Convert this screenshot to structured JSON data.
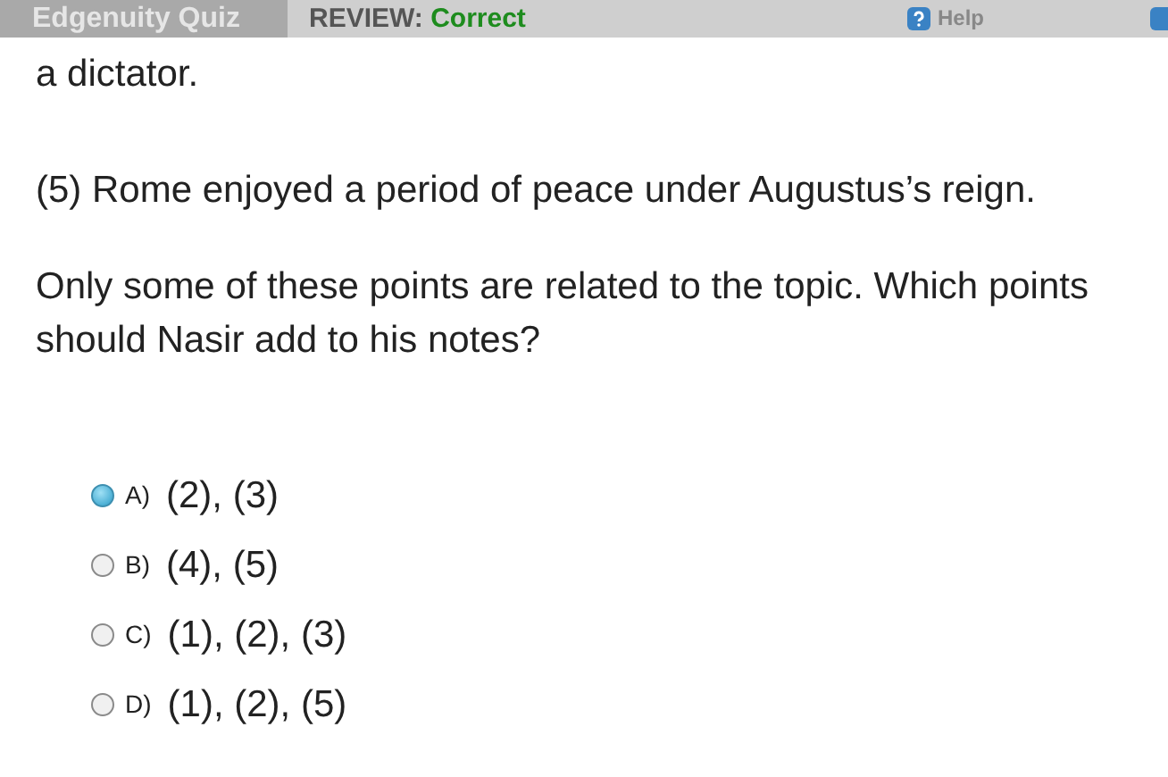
{
  "header": {
    "title": "Edgenuity Quiz",
    "review_label": "REVIEW:",
    "review_status": "Correct",
    "help": "Help"
  },
  "paragraphs": [
    "a dictator.",
    "(5) Rome enjoyed a period of peace under Augustus’s reign.",
    "Only some of these points are related to the topic. Which points should Nasir add to his notes?"
  ],
  "options": [
    {
      "letter": "A)",
      "text": "(2), (3)",
      "selected": true
    },
    {
      "letter": "B)",
      "text": "(4), (5)",
      "selected": false
    },
    {
      "letter": "C)",
      "text": "(1), (2), (3)",
      "selected": false
    },
    {
      "letter": "D)",
      "text": "(1), (2), (5)",
      "selected": false
    }
  ]
}
